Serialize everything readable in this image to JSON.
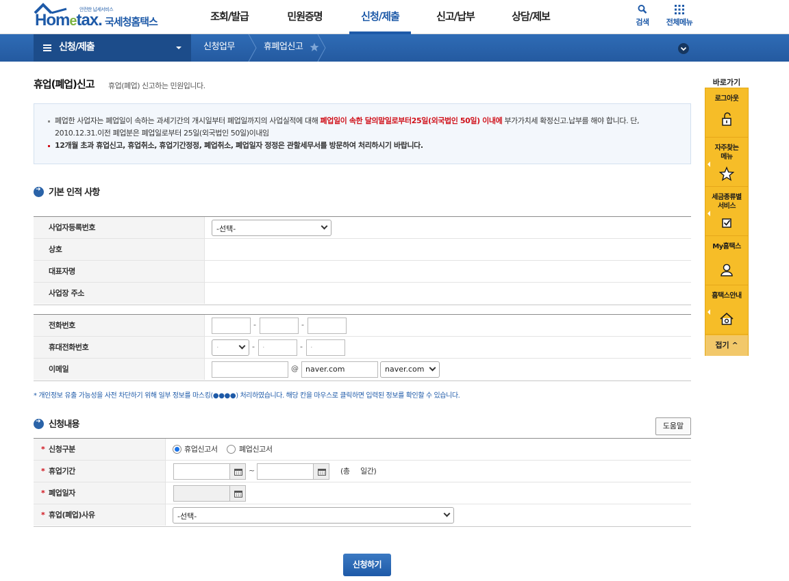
{
  "header": {
    "logo_small": "안전한 납세서비스",
    "logo_brand_pre": "Hom",
    "logo_brand_e": "e",
    "logo_brand_post": "tax.",
    "logo_kor": "국세청홈택스",
    "nav": [
      "조회/발급",
      "민원증명",
      "신청/제출",
      "신고/납부",
      "상담/제보"
    ],
    "search_label": "검색",
    "allmenu_label": "전체메뉴"
  },
  "location": {
    "menu_label": "신청/제출",
    "crumbs": [
      "신청업무",
      "휴폐업신고"
    ]
  },
  "page": {
    "title": "휴업(폐업)신고",
    "desc": "휴업(폐업) 신고하는 민원입니다."
  },
  "notice": {
    "l1_a": "폐업한 사업자는 폐업일이 속하는 과세기간의 개시일부터 폐업일까지의 사업실적에 대해 ",
    "l1_red": "폐업일이 속한 달의말일로부터25일(외국법인 50일) 이내에",
    "l1_b": " 부가가치세 확정신고.납부를 해야 합니다. 단,",
    "l2": "2010.12.31.이전 폐업분은 폐업일로부터 25일(외국법인 50일)이내임",
    "l3_red": "12개월 초과 휴업신고, 휴업취소, 휴업기간정정, 폐업취소, 폐업일자 정정은 관할세무서를 방문하여 처리하시기 바랍니다."
  },
  "basic": {
    "title": "기본 인적 사항",
    "rows": {
      "bizno": "사업자등록번호",
      "bizno_select": "-선택-",
      "trade": "상호",
      "rep": "대표자명",
      "addr": "사업장 주소",
      "phone": "전화번호",
      "mobile": "휴대전화번호",
      "email": "이메일",
      "email_at": "@",
      "email_domain": "naver.com",
      "email_select": "naver.com"
    },
    "privacy_note": "* 개인정보 유출 가능성을 사전 차단하기 위해 일부 정보를 마스킹(●●●●) 처리하였습니다. 해당 칸을 마우스로 클릭하면 입력된 정보를 확인할 수 있습니다."
  },
  "apply": {
    "title": "신청내용",
    "help": "도움말",
    "type_label": "신청구분",
    "opt1": "휴업신고서",
    "opt2": "폐업신고서",
    "period_label": "휴업기간",
    "tilde": "~",
    "total": "(총     일간)",
    "close_date_label": "폐업일자",
    "reason_label": "휴업(폐업)사유",
    "reason_select": "-선택-",
    "submit": "신청하기"
  },
  "quick": {
    "title": "바로가기",
    "items": [
      "로그아웃",
      "자주찾는\n메뉴",
      "세금종류별\n서비스",
      "My홈택스",
      "홈택스안내"
    ],
    "close": "접기"
  },
  "colors": {
    "brand": "#1e5aa8",
    "red": "#d0121b",
    "quick": "#f6bd28"
  }
}
